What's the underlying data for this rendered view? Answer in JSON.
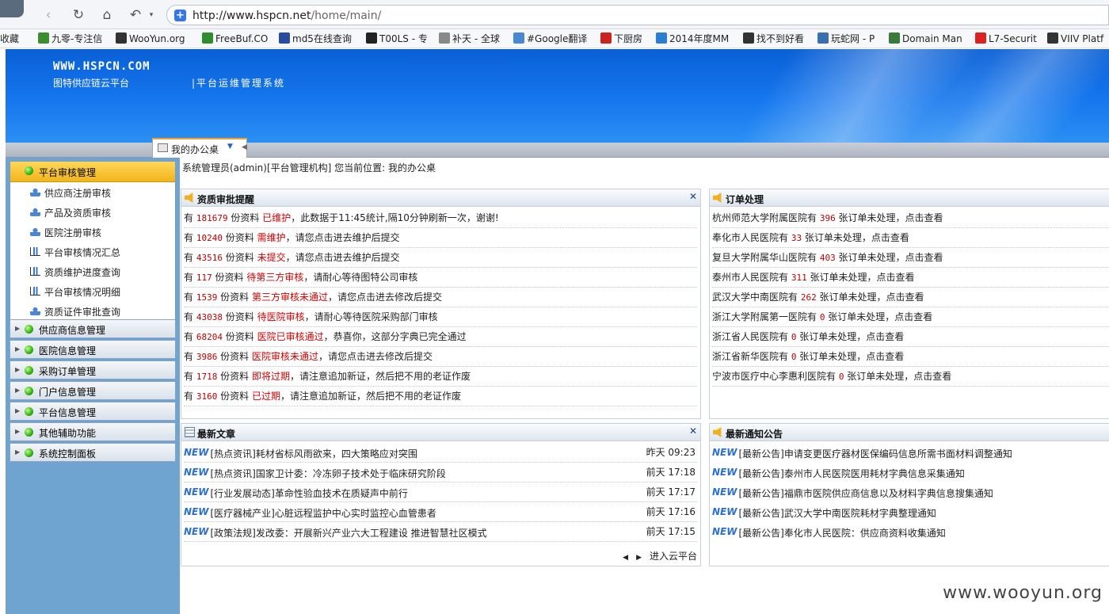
{
  "browser": {
    "url_base": "http://www.hspcn.net",
    "url_path": "/home/main/",
    "bookmarks": [
      "收藏",
      "九零-专注信",
      "WooYun.org",
      "FreeBuf.CO",
      "md5在线查询",
      "T00LS - 专",
      "补天 - 全球",
      "#Google翻译",
      "下厨房",
      "2014年度MM",
      "找不到好看",
      "玩蛇网 - P",
      "Domain Man",
      "L7-Securit",
      "VIIV Platf"
    ]
  },
  "header": {
    "site": "WWW.HSPCN.COM",
    "brand": "图特供应链云平台",
    "system": "|平台运维管理系统"
  },
  "tab": {
    "label": "我的办公桌"
  },
  "sidebar": {
    "active_group": "平台审核管理",
    "items": [
      {
        "label": "供应商注册审核",
        "icon": "user-icon"
      },
      {
        "label": "产品及资质审核",
        "icon": "user-icon"
      },
      {
        "label": "医院注册审核",
        "icon": "user-icon"
      },
      {
        "label": "平台审核情况汇总",
        "icon": "chart-icon"
      },
      {
        "label": "资质维护进度查询",
        "icon": "chart-icon"
      },
      {
        "label": "平台审核情况明细",
        "icon": "chart-icon"
      },
      {
        "label": "资质证件审批查询",
        "icon": "user-icon"
      }
    ],
    "groups": [
      "供应商信息管理",
      "医院信息管理",
      "采购订单管理",
      "门户信息管理",
      "平台信息管理",
      "其他辅助功能",
      "系统控制面板"
    ]
  },
  "crumb": "系统管理员(admin)[平台管理机构]   您当前位置: 我的办公桌",
  "qual_panel": {
    "title": "资质审批提醒",
    "rows": [
      {
        "pre": "有 ",
        "count": "181679",
        "mid": " 份资料 ",
        "status": "已维护",
        "tail": "，此数据于11:45统计,隔10分钟刷新一次，谢谢!"
      },
      {
        "pre": "有 ",
        "count": "10240",
        "mid": " 份资料 ",
        "status": "需维护",
        "tail": "，请您点击进去维护后提交"
      },
      {
        "pre": "有 ",
        "count": "43516",
        "mid": " 份资料 ",
        "status": "未提交",
        "tail": "，请您点击进去维护后提交"
      },
      {
        "pre": "有 ",
        "count": "117",
        "mid": " 份资料 ",
        "status": "待第三方审核",
        "tail": "，请耐心等待图特公司审核"
      },
      {
        "pre": "有 ",
        "count": "1539",
        "mid": " 份资料 ",
        "status": "第三方审核未通过",
        "tail": "，请您点击进去修改后提交"
      },
      {
        "pre": "有 ",
        "count": "43038",
        "mid": " 份资料 ",
        "status": "待医院审核",
        "tail": "，请耐心等待医院采购部门审核"
      },
      {
        "pre": "有 ",
        "count": "68204",
        "mid": " 份资料 ",
        "status": "医院已审核通过",
        "tail": "，恭喜你，这部分字典已完全通过"
      },
      {
        "pre": "有 ",
        "count": "3986",
        "mid": " 份资料 ",
        "status": "医院审核未通过",
        "tail": "，请您点击进去修改后提交"
      },
      {
        "pre": "有 ",
        "count": "1718",
        "mid": " 份资料 ",
        "status": "即将过期",
        "tail": "，请注意追加新证，然后把不用的老证作废"
      },
      {
        "pre": "有 ",
        "count": "3160",
        "mid": " 份资料 ",
        "status": "已过期",
        "tail": "，请注意追加新证，然后把不用的老证作废"
      }
    ]
  },
  "order_panel": {
    "title": "订单处理",
    "rows": [
      {
        "hospital": "杭州师范大学附属医院有 ",
        "count": "396",
        "tail": " 张订单未处理，点击查看"
      },
      {
        "hospital": "奉化市人民医院有 ",
        "count": "33",
        "tail": " 张订单未处理，点击查看"
      },
      {
        "hospital": "复旦大学附属华山医院有 ",
        "count": "403",
        "tail": " 张订单未处理，点击查看"
      },
      {
        "hospital": "泰州市人民医院有 ",
        "count": "311",
        "tail": " 张订单未处理，点击查看"
      },
      {
        "hospital": "武汉大学中南医院有 ",
        "count": "262",
        "tail": " 张订单未处理，点击查看"
      },
      {
        "hospital": "浙江大学附属第一医院有 ",
        "count": "0",
        "tail": " 张订单未处理，点击查看"
      },
      {
        "hospital": "浙江省人民医院有 ",
        "count": "0",
        "tail": " 张订单未处理，点击查看"
      },
      {
        "hospital": "浙江省新华医院有 ",
        "count": "0",
        "tail": " 张订单未处理，点击查看"
      },
      {
        "hospital": "宁波市医疗中心李惠利医院有 ",
        "count": "0",
        "tail": " 张订单未处理，点击查看"
      }
    ]
  },
  "article_panel": {
    "title": "最新文章",
    "badge": "NEW",
    "rows": [
      {
        "text": "[热点资讯]耗材省标风雨欲来，四大策略应对突围",
        "time": "昨天 09:23"
      },
      {
        "text": "[热点资讯]国家卫计委：冷冻卵子技术处于临床研究阶段",
        "time": "前天 17:18"
      },
      {
        "text": "[行业发展动态]革命性验血技术在质疑声中前行",
        "time": "前天 17:17"
      },
      {
        "text": "[医疗器械产业]心脏远程监护中心实时监控心血管患者",
        "time": "前天 17:16"
      },
      {
        "text": "[政策法规]发改委：开展新兴产业六大工程建设 推进智慧社区模式",
        "time": "前天 17:15"
      }
    ],
    "more": "进入云平台"
  },
  "notice_panel": {
    "title": "最新通知公告",
    "rows": [
      "[最新公告]申请变更医疗器材医保编码信息所需书面材料调整通知",
      "[最新公告]泰州市人民医院医用耗材字典信息采集通知",
      "[最新公告]福鼎市医院供应商信息以及材料字典信息搜集通知",
      "[最新公告]武汉大学中南医院耗材字典整理通知",
      "[最新公告]奉化市人民医院：供应商资料收集通知"
    ]
  },
  "watermark": "www.wooyun.org"
}
